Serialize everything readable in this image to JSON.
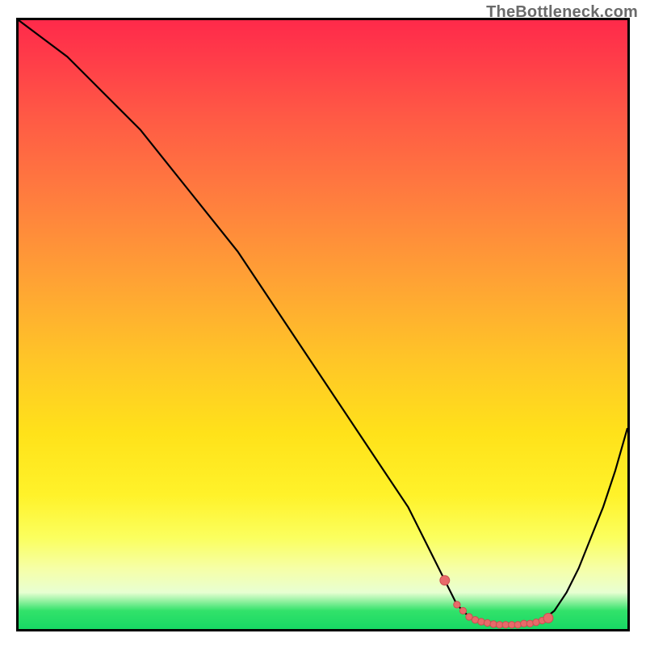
{
  "watermark": "TheBottleneck.com",
  "colors": {
    "curve": "#000000",
    "marker_fill": "#e86a6a",
    "marker_stroke": "#c94f4f"
  },
  "chart_data": {
    "type": "line",
    "title": "",
    "xlabel": "",
    "ylabel": "",
    "xlim": [
      0,
      100
    ],
    "ylim": [
      0,
      100
    ],
    "grid": false,
    "legend": false,
    "series": [
      {
        "name": "bottleneck_curve",
        "x": [
          0,
          4,
          8,
          12,
          16,
          20,
          24,
          28,
          32,
          36,
          40,
          44,
          48,
          52,
          56,
          60,
          64,
          68,
          70,
          72,
          74,
          76,
          78,
          80,
          82,
          84,
          86,
          88,
          90,
          92,
          94,
          96,
          98,
          100
        ],
        "y": [
          100,
          97,
          94,
          90,
          86,
          82,
          77,
          72,
          67,
          62,
          56,
          50,
          44,
          38,
          32,
          26,
          20,
          12,
          8,
          4,
          2,
          1.2,
          0.8,
          0.7,
          0.7,
          0.9,
          1.4,
          3,
          6,
          10,
          15,
          20,
          26,
          33
        ]
      }
    ],
    "markers": {
      "name": "flat_region_markers",
      "x": [
        70,
        72,
        73,
        74,
        75,
        76,
        77,
        78,
        79,
        80,
        81,
        82,
        83,
        84,
        85,
        86,
        87
      ],
      "y": [
        8,
        4,
        3,
        2,
        1.5,
        1.2,
        1.0,
        0.8,
        0.7,
        0.7,
        0.7,
        0.7,
        0.9,
        0.9,
        1.1,
        1.4,
        1.8
      ],
      "colored_for_y_below": 10
    },
    "gradient_note": "vertical gradient red→orange→yellow→green mapping high→low bottleneck"
  }
}
